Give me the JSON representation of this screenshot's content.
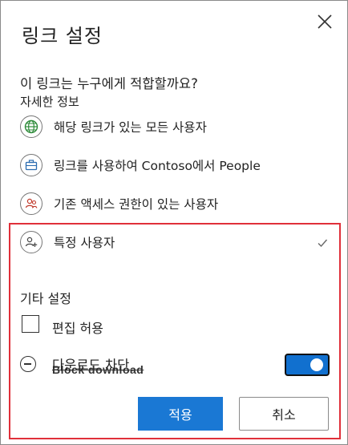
{
  "dialog": {
    "title": "링크 설정",
    "question": "이 링크는 누구에게 적합할까요?",
    "more_info": "자세한 정보"
  },
  "options": [
    {
      "label": "해당 링크가 있는 모든 사용자",
      "icon": "globe-icon",
      "color": "#2e8b3a"
    },
    {
      "label": "링크를 사용하여 Contoso에서 People",
      "icon": "briefcase-icon",
      "color": "#2b6cb0"
    },
    {
      "label": "기존 액세스 권한이 있는 사용자",
      "icon": "people-icon",
      "color": "#c0392b"
    },
    {
      "label": "특정 사용자",
      "icon": "people-add-icon",
      "color": "#555555",
      "selected": true
    }
  ],
  "other_settings": {
    "heading": "기타 설정",
    "allow_edit_label": "편집 허용",
    "allow_edit_checked": false,
    "block_download_label": "다운로드 차단",
    "block_download_ghost": "Block download",
    "block_download_on": true
  },
  "buttons": {
    "apply": "적용",
    "cancel": "취소"
  },
  "colors": {
    "accent": "#1a78d4",
    "highlight_border": "#e0303a"
  }
}
